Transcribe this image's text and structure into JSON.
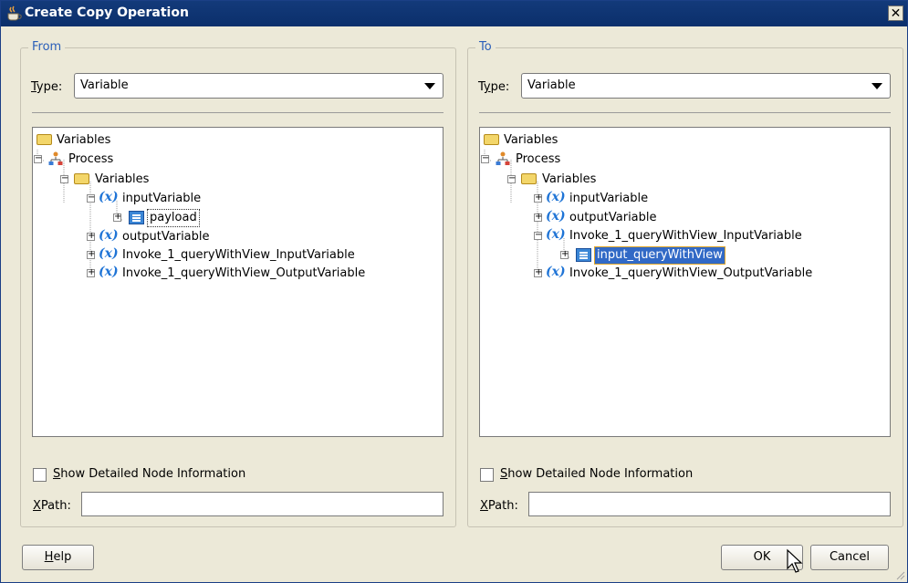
{
  "window": {
    "title": "Create Copy Operation",
    "close_glyph": "✕"
  },
  "from": {
    "legend": "From",
    "type_label_prefix": "",
    "type_label_u": "T",
    "type_label_rest": "ype:",
    "type_value": "Variable",
    "tree": {
      "root": "Variables",
      "process": "Process",
      "variables": "Variables",
      "items": [
        "inputVariable",
        "payload",
        "outputVariable",
        "Invoke_1_queryWithView_InputVariable",
        "Invoke_1_queryWithView_OutputVariable"
      ]
    },
    "checkbox_u": "S",
    "checkbox_rest": "how Detailed Node Information",
    "xpath_u": "X",
    "xpath_rest": "Path:",
    "xpath_value": ""
  },
  "to": {
    "legend": "To",
    "type_label_prefix": "T",
    "type_label_u": "y",
    "type_label_rest": "pe:",
    "type_value": "Variable",
    "tree": {
      "root": "Variables",
      "process": "Process",
      "variables": "Variables",
      "items": [
        "inputVariable",
        "outputVariable",
        "Invoke_1_queryWithView_InputVariable",
        "input_queryWithView",
        "Invoke_1_queryWithView_OutputVariable"
      ]
    },
    "checkbox_u": "S",
    "checkbox_rest": "how Detailed Node Information",
    "xpath_u": "X",
    "xpath_rest": "Path:",
    "xpath_value": ""
  },
  "buttons": {
    "help_u": "H",
    "help_rest": "elp",
    "ok": "OK",
    "cancel": "Cancel"
  },
  "colors": {
    "titlebar": "#0b2f6b",
    "dialog_bg": "#ece9d8",
    "legend": "#2b5fb9",
    "selection": "#3169c6",
    "variable_icon": "#1f74d6"
  }
}
